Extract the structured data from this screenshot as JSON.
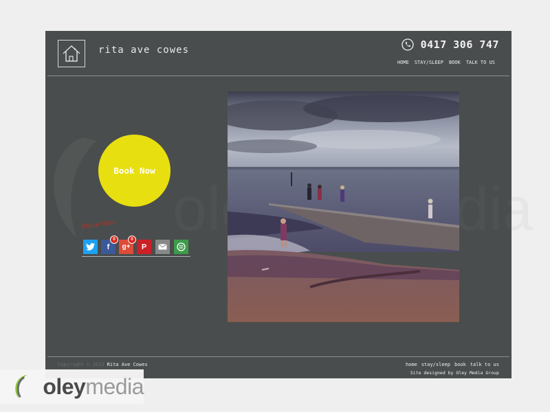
{
  "site": {
    "name": "rita ave cowes",
    "phone": "0417 306 747",
    "nav": [
      "HOME",
      "STAY/SLEEP",
      "BOOK",
      "TALK TO US"
    ],
    "book_now": "Book Now",
    "share_label": "Share this:"
  },
  "share": {
    "buttons": [
      {
        "name": "twitter",
        "color": "#1da1f2"
      },
      {
        "name": "facebook",
        "color": "#3b5998",
        "count": "0"
      },
      {
        "name": "google-plus",
        "color": "#dd4b39",
        "count": "0"
      },
      {
        "name": "pinterest",
        "color": "#cb2027"
      },
      {
        "name": "email",
        "color": "#888888"
      },
      {
        "name": "share-this",
        "color": "#3d9b49"
      }
    ]
  },
  "footer": {
    "copyright": "Copyright © 2013",
    "owner": "Rita Ave Cowes",
    "nav": [
      "home",
      "stay/sleep",
      "book",
      "talk to us"
    ],
    "credit": "Site designed by Oley Media Group"
  },
  "watermark": {
    "part1": "oley",
    "part2": "media"
  },
  "colors": {
    "site_bg": "#4a4d4d",
    "book_now": "#e8df10",
    "page_bg": "#efefef"
  }
}
